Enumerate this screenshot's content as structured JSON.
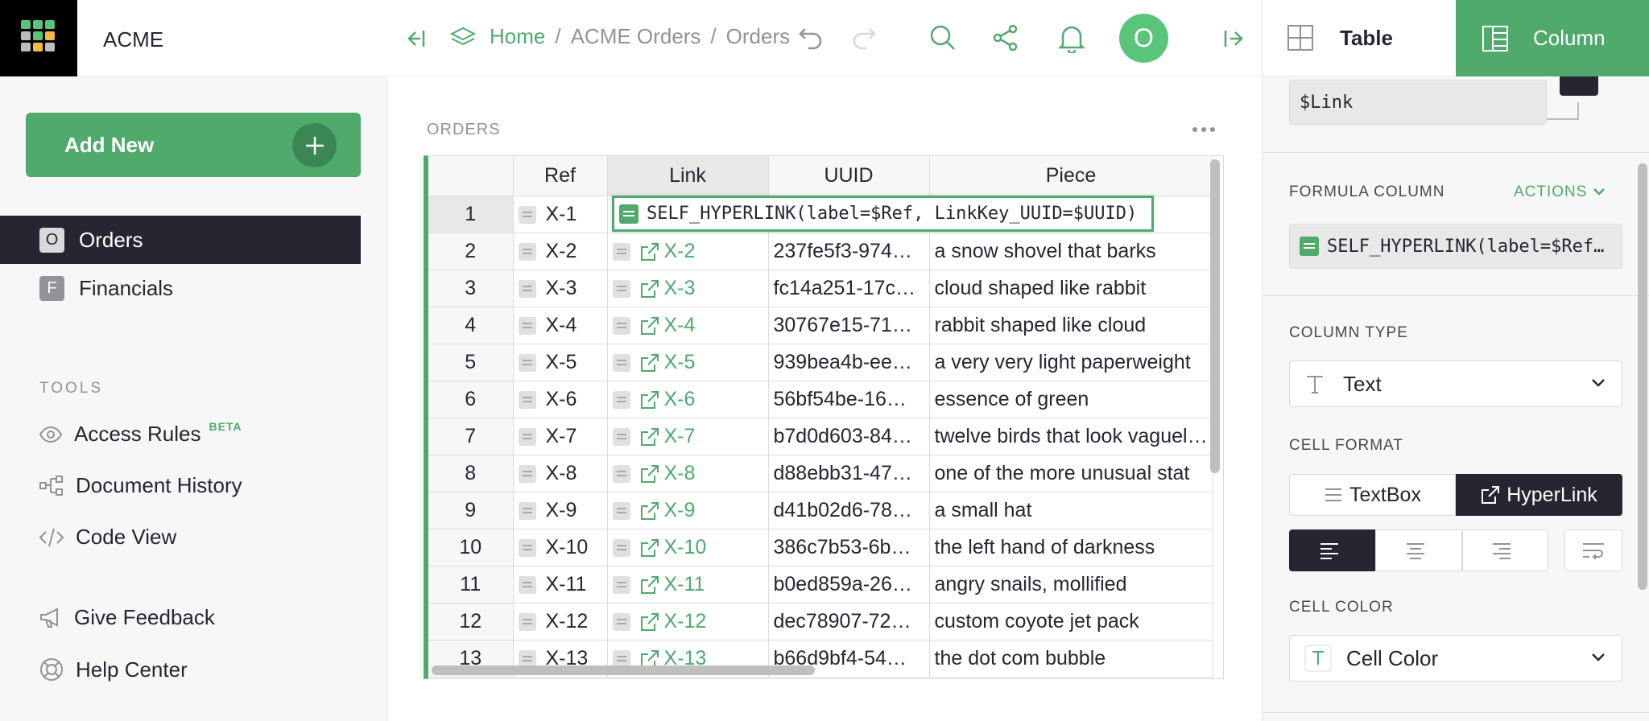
{
  "app": {
    "org_name": "ACME",
    "add_new_label": "Add New"
  },
  "pages": [
    {
      "badge": "O",
      "label": "Orders",
      "active": true
    },
    {
      "badge": "F",
      "label": "Financials",
      "active": false
    }
  ],
  "tools": {
    "header": "TOOLS",
    "access_rules": "Access Rules",
    "beta": "BETA",
    "document_history": "Document History",
    "code_view": "Code View",
    "give_feedback": "Give Feedback",
    "help_center": "Help Center"
  },
  "topbar": {
    "crumbs": [
      "Home",
      "/",
      "ACME Orders",
      "/",
      "Orders"
    ],
    "avatar_initial": "O"
  },
  "right_tabs": {
    "table": "Table",
    "column": "Column"
  },
  "section": {
    "title": "ORDERS"
  },
  "grid": {
    "columns": [
      "Ref",
      "Link",
      "UUID",
      "Piece"
    ],
    "editor_formula": "SELF_HYPERLINK(label=$Ref, LinkKey_UUID=$UUID)",
    "rows": [
      {
        "n": "1",
        "ref": "X-1",
        "link": "",
        "uuid": "",
        "piece": ""
      },
      {
        "n": "2",
        "ref": "X-2",
        "link": "X-2",
        "uuid": "237fe5f3-974…",
        "piece": "a snow shovel that barks"
      },
      {
        "n": "3",
        "ref": "X-3",
        "link": "X-3",
        "uuid": "fc14a251-17c…",
        "piece": "cloud shaped like rabbit"
      },
      {
        "n": "4",
        "ref": "X-4",
        "link": "X-4",
        "uuid": "30767e15-71…",
        "piece": "rabbit shaped like cloud"
      },
      {
        "n": "5",
        "ref": "X-5",
        "link": "X-5",
        "uuid": "939bea4b-ee…",
        "piece": "a very very light paperweight"
      },
      {
        "n": "6",
        "ref": "X-6",
        "link": "X-6",
        "uuid": "56bf54be-16…",
        "piece": "essence of green"
      },
      {
        "n": "7",
        "ref": "X-7",
        "link": "X-7",
        "uuid": "b7d0d603-84…",
        "piece": "twelve birds that look vaguel…"
      },
      {
        "n": "8",
        "ref": "X-8",
        "link": "X-8",
        "uuid": "d88ebb31-47…",
        "piece": "one of the more unusual stat"
      },
      {
        "n": "9",
        "ref": "X-9",
        "link": "X-9",
        "uuid": "d41b02d6-78…",
        "piece": "a small hat"
      },
      {
        "n": "10",
        "ref": "X-10",
        "link": "X-10",
        "uuid": "386c7b53-6b…",
        "piece": "the left hand of darkness"
      },
      {
        "n": "11",
        "ref": "X-11",
        "link": "X-11",
        "uuid": "b0ed859a-26…",
        "piece": "angry snails, mollified"
      },
      {
        "n": "12",
        "ref": "X-12",
        "link": "X-12",
        "uuid": "dec78907-72…",
        "piece": "custom coyote jet pack"
      },
      {
        "n": "13",
        "ref": "X-13",
        "link": "X-13",
        "uuid": "b66d9bf4-54…",
        "piece": "the dot com bubble"
      }
    ]
  },
  "column_panel": {
    "col_id": "$Link",
    "formula_header": "FORMULA COLUMN",
    "actions": "ACTIONS",
    "formula_preview": "SELF_HYPERLINK(label=$Ref…",
    "column_type_header": "COLUMN TYPE",
    "column_type": "Text",
    "cell_format_header": "CELL FORMAT",
    "fmt_textbox": "TextBox",
    "fmt_hyperlink": "HyperLink",
    "cell_color_header": "CELL COLOR",
    "cell_color": "Cell Color"
  },
  "colors": {
    "accent": "#4faa6c",
    "dark": "#262633"
  }
}
